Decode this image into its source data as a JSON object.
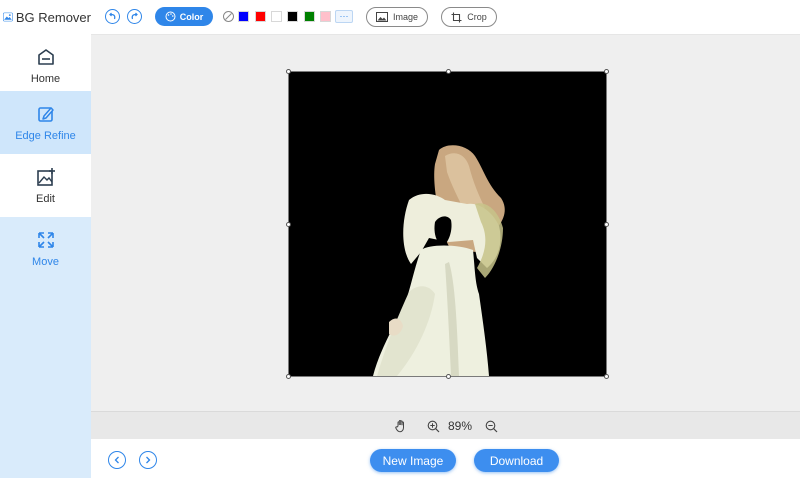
{
  "app": {
    "title": "BG Remover"
  },
  "sidebar": {
    "items": [
      {
        "label": "Home",
        "icon": "home-icon"
      },
      {
        "label": "Edge Refine",
        "icon": "edge-refine-icon"
      },
      {
        "label": "Edit",
        "icon": "edit-image-icon"
      },
      {
        "label": "Move",
        "icon": "move-icon"
      }
    ]
  },
  "toolbar": {
    "undo_icon": "undo-icon",
    "redo_icon": "redo-icon",
    "color_label": "Color",
    "swatches": [
      "none",
      "#0000ff",
      "#ff0000",
      "#ffffff",
      "#000000",
      "#008000",
      "#ffc0cb"
    ],
    "more_label": "···",
    "image_label": "Image",
    "crop_label": "Crop"
  },
  "canvas": {
    "background_color": "#000000",
    "subject": "woman in white dress, back view"
  },
  "zoom": {
    "value": "89%"
  },
  "bottom": {
    "new_image_label": "New Image",
    "download_label": "Download"
  },
  "colors": {
    "accent": "#2f86e9",
    "sidebar_bg": "#d9ebfb",
    "canvas_bg": "#efefef"
  }
}
